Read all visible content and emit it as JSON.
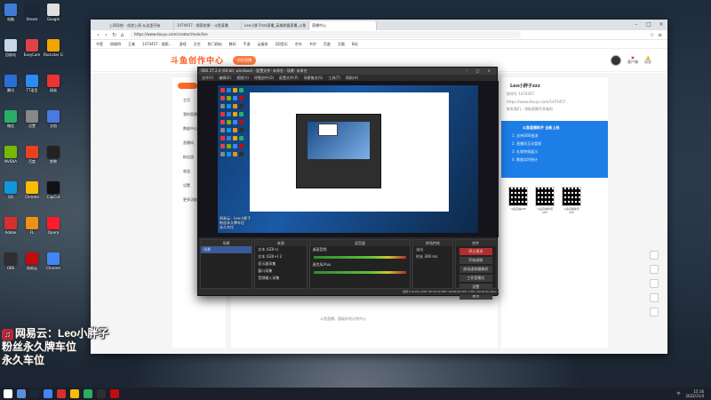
{
  "desktop": {
    "icons": [
      {
        "label": "电脑",
        "color": "#3d7bd6"
      },
      {
        "label": "Steam",
        "color": "#1b2838"
      },
      {
        "label": "Google",
        "color": "#e0e0e0"
      },
      {
        "label": "回收站",
        "color": "#c9d6e4"
      },
      {
        "label": "EasyCam",
        "color": "#d44"
      },
      {
        "label": "Rockstar Games",
        "color": "#f0a500"
      },
      {
        "label": "腾讯",
        "color": "#2a6fd6"
      },
      {
        "label": "TT语音",
        "color": "#2d8cf0"
      },
      {
        "label": "网易",
        "color": "#e33"
      },
      {
        "label": "微信",
        "color": "#2aae67"
      },
      {
        "label": "设置",
        "color": "#888"
      },
      {
        "label": "文档",
        "color": "#4a7ae0"
      },
      {
        "label": "NVIDIA",
        "color": "#76b900"
      },
      {
        "label": "百度",
        "color": "#e8421f"
      },
      {
        "label": "剪映",
        "color": "#222"
      },
      {
        "label": "QQ",
        "color": "#1296db"
      },
      {
        "label": "Chrome",
        "color": "#fbbc04"
      },
      {
        "label": "CapCut",
        "color": "#111"
      },
      {
        "label": "Adobe",
        "color": "#d62f2f"
      },
      {
        "label": "FL",
        "color": "#ee8f1a"
      },
      {
        "label": "Opera",
        "color": "#ff1b2d"
      },
      {
        "label": "OBS",
        "color": "#302e31"
      },
      {
        "label": "网易云",
        "color": "#c20c0c"
      },
      {
        "label": "Chrome",
        "color": "#4285f4"
      }
    ]
  },
  "browser": {
    "tabs": [
      "上网导航 - 创造上网 从这里开始",
      "1474457 - 搜索结果 - 斗鱼直播",
      "Leo小胖子zzz直播_英雄联盟直播_斗鱼",
      "直播中心"
    ],
    "url": "https://www.douyu.com/creator/main/live",
    "bookmarks": [
      "书签",
      "网络四",
      "王者",
      "1474457 - 搜索...",
      "游戏",
      "天空",
      "热门网站",
      "数码",
      "手游",
      "云服务",
      "QQ音乐",
      "京东",
      "书字",
      "百度",
      "天猫",
      "B站"
    ],
    "site": {
      "logo": "斗鱼创作中心",
      "action_button": "前往直播",
      "header_items": [
        "客户端",
        "消息"
      ],
      "left_nav": [
        "主页",
        "我的直播",
        "数据中心",
        "直播间",
        "粉丝团",
        "收益",
        "设置",
        "更多功能"
      ],
      "center_footer": "斗鱼直播，超级好的计划中心",
      "right": {
        "username": "Leo小胖子zzz",
        "room_id": "房间号 1474457",
        "url_line": "https://www.douyu.com/1474457",
        "tip": "联系我们，领取直播专享福利",
        "promo_title": "斗鱼直播助手 全新上线",
        "promo_lines": [
          "1. 支持OBS推流",
          "2. 直播间互动管理",
          "3. 礼物特效展示",
          "4. 数据实时统计"
        ],
        "qr_captions": [
          "斗鱼直播APP",
          "斗鱼直播伴侣APP",
          "斗鱼直播助手APP"
        ]
      }
    }
  },
  "obs": {
    "title": "OBS 27.2.4 (64-bit, windows) - 配置文件: 未命名 - 场景: 未命名",
    "menu": [
      "文件(F)",
      "编辑(E)",
      "视图(V)",
      "停靠部件(D)",
      "配置文件(P)",
      "场景集合(S)",
      "工具(T)",
      "帮助(H)"
    ],
    "overlay_small": [
      "网易云：Leo小胖子",
      "粉丝永久牌车位",
      "永久车位"
    ],
    "docks": {
      "scenes_header": "场景",
      "scenes": [
        "场景"
      ],
      "sources_header": "来源",
      "sources": [
        "文本 (GDI+)",
        "文本 (GDI+) 2",
        "显示器采集",
        "窗口采集",
        "音频输入采集"
      ],
      "mixer_header": "混音器",
      "mixer": [
        "桌面音频",
        "麦克风/Aux"
      ],
      "transitions_header": "转场特效",
      "transition_value": "淡出",
      "duration_label": "时长",
      "duration_value": "300 ms",
      "controls_header": "控件",
      "controls": [
        "停止推流",
        "开始录制",
        "启动虚拟摄像机",
        "工作室模式",
        "设置",
        "退出"
      ]
    },
    "status": "丢帧 0 (0.0%)  LIVE: 00:18:32  REC: 00:00:00  CPU: 4.8%, 60.00 fps  kb/s: 4516"
  },
  "overlay": {
    "lines": [
      "网易云：Leo小胖子",
      "粉丝永久牌车位",
      "永久车位"
    ]
  },
  "taskbar": {
    "time": "15:16",
    "date": "2022/11/4",
    "lang": "中",
    "icons": [
      {
        "color": "#ffffff"
      },
      {
        "color": "#5b8fd8"
      },
      {
        "color": "#1b2838"
      },
      {
        "color": "#4285f4"
      },
      {
        "color": "#d62f2f"
      },
      {
        "color": "#fbbc04"
      },
      {
        "color": "#2aae67"
      },
      {
        "color": "#302e31"
      },
      {
        "color": "#c20c0c"
      }
    ]
  }
}
